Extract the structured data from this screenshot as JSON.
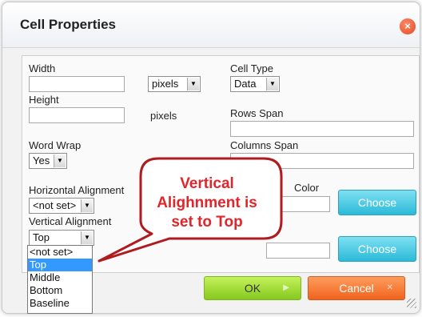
{
  "dialog": {
    "title": "Cell Properties",
    "close_glyph": "×"
  },
  "fields": {
    "width_label": "Width",
    "width_unit": "pixels",
    "height_label": "Height",
    "height_unit": "pixels",
    "word_wrap_label": "Word Wrap",
    "word_wrap_value": "Yes",
    "horizontal_alignment_label": "Horizontal Alignment",
    "horizontal_alignment_value": "<not set>",
    "vertical_alignment_label": "Vertical Alignment",
    "vertical_alignment_value": "Top",
    "cell_type_label": "Cell Type",
    "cell_type_value": "Data",
    "rows_span_label": "Rows Span",
    "columns_span_label": "Columns Span",
    "color_label_partial": "Color"
  },
  "dropdown_options": [
    "<not set>",
    "Top",
    "Middle",
    "Bottom",
    "Baseline"
  ],
  "dropdown_selected": "Top",
  "buttons": {
    "choose_label": "Choose",
    "ok_label": "OK",
    "cancel_label": "Cancel"
  },
  "callout": {
    "line1": "Vertical",
    "line2": "Alighnment is",
    "line3": "set to Top"
  },
  "colors": {
    "callout_text": "#e0262a",
    "choose_button": "#2bbad8",
    "ok_button": "#86c81f",
    "cancel_button": "#f0631f",
    "selected_option": "#3399ff"
  },
  "icons": [
    "close-icon",
    "dropdown-arrow-icon",
    "resize-grip-icon"
  ]
}
